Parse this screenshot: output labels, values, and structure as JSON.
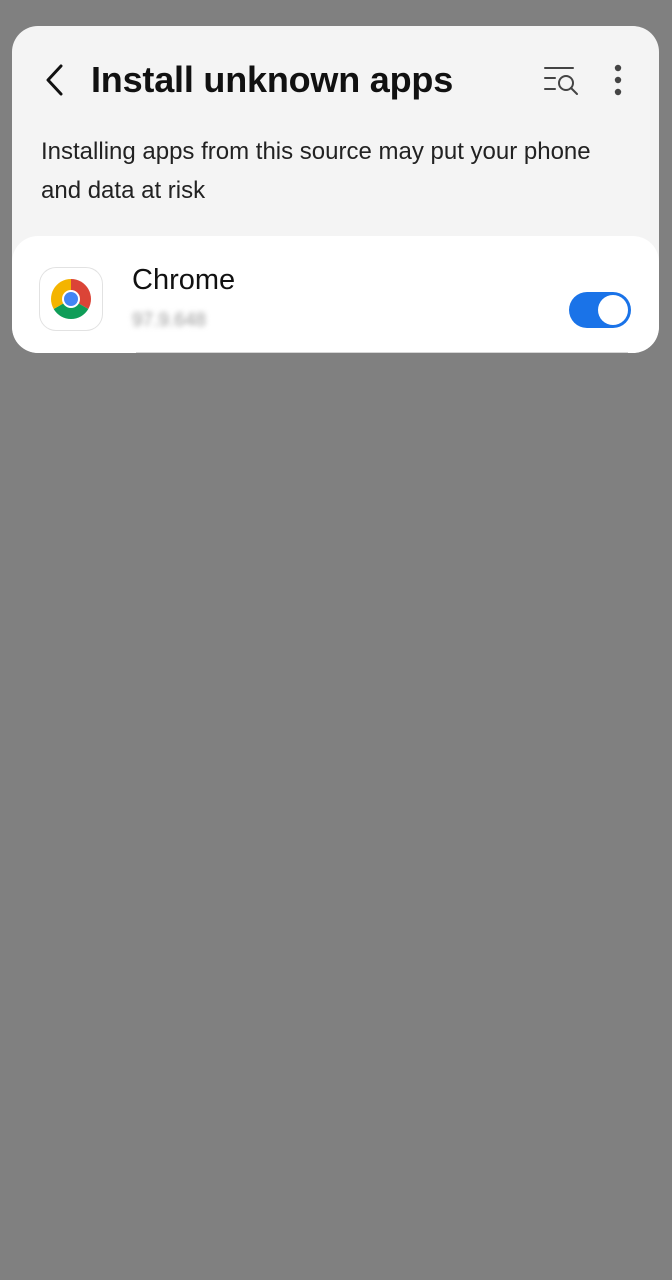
{
  "header": {
    "title": "Install unknown apps",
    "back_icon": "chevron-left-icon",
    "search_icon": "list-search-icon",
    "more_icon": "more-vertical-icon"
  },
  "warning": {
    "text": "Installing apps from this source may put your phone and data at risk"
  },
  "apps": [
    {
      "name": "Chrome",
      "version": "97.9.648",
      "icon": "chrome-icon",
      "allowed": true
    }
  ],
  "colors": {
    "toggle_on": "#1a73e8",
    "background_dim": "#808080",
    "card_bg": "#f4f4f4",
    "list_bg": "#ffffff"
  }
}
